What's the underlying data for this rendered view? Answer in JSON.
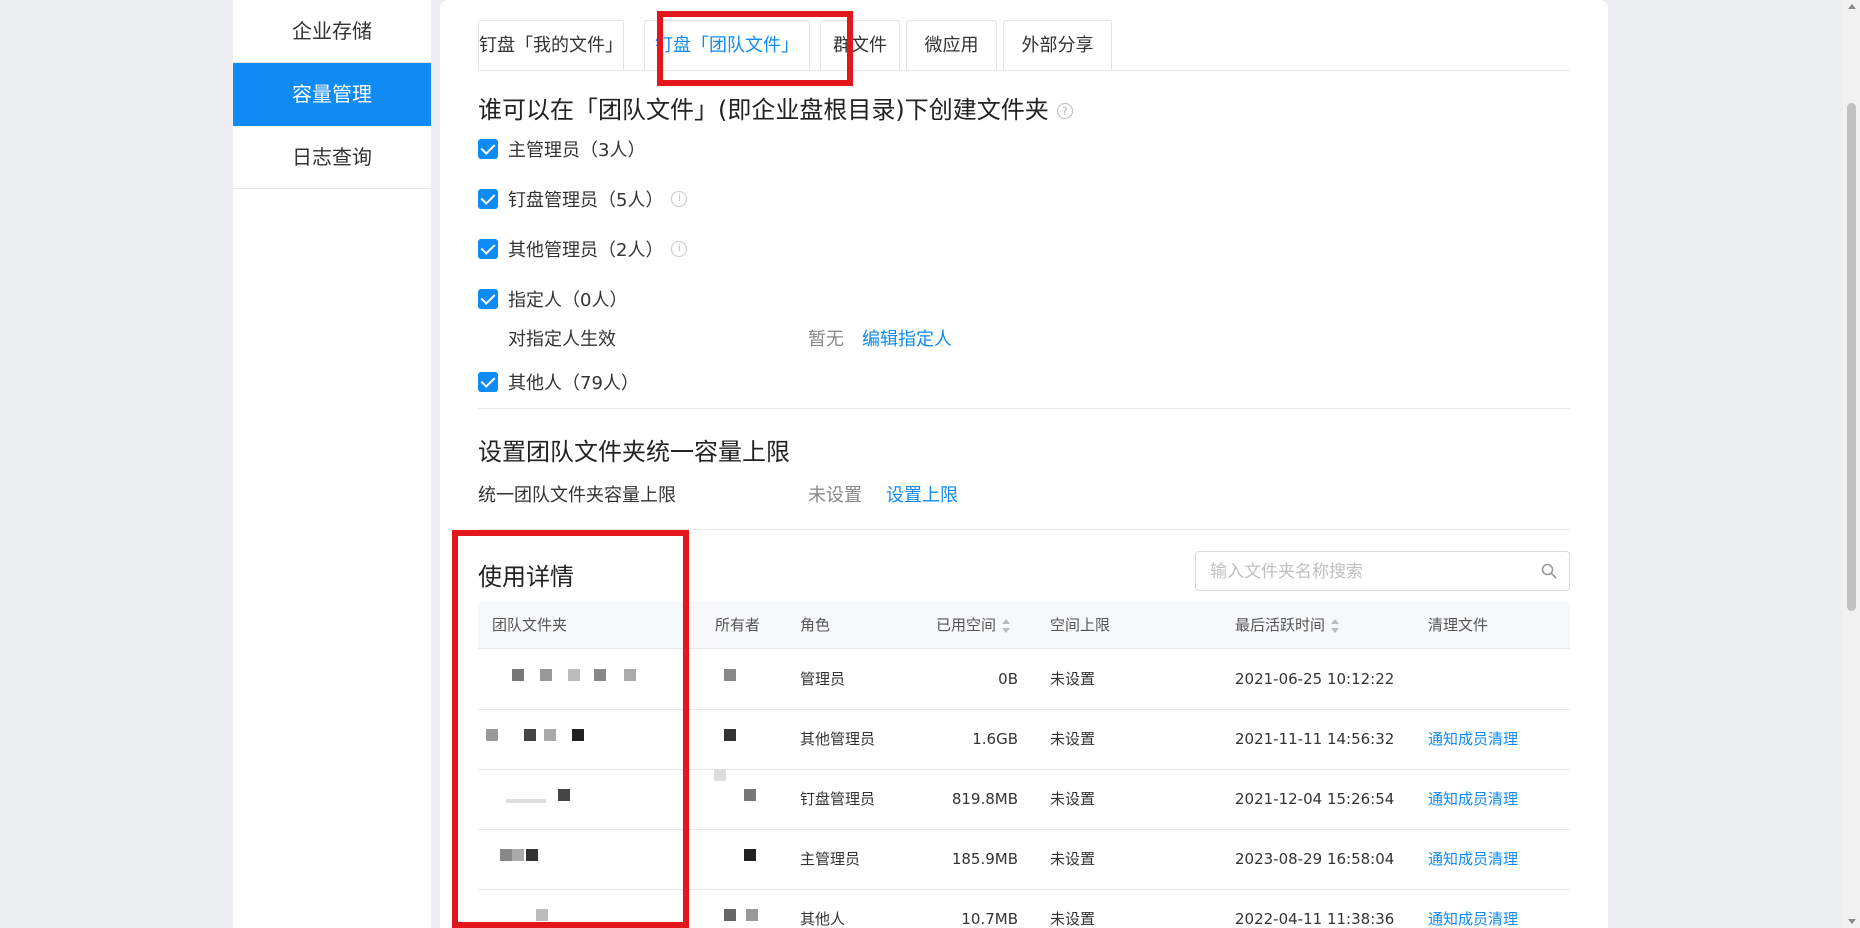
{
  "sidebar": {
    "items": [
      {
        "label": "企业存储",
        "active": false
      },
      {
        "label": "容量管理",
        "active": true
      },
      {
        "label": "日志查询",
        "active": false
      }
    ]
  },
  "tabs": [
    {
      "label": "钉盘「我的文件」",
      "active": false
    },
    {
      "label": "钉盘「团队文件」",
      "active": true
    },
    {
      "label": "群文件",
      "active": false
    },
    {
      "label": "微应用",
      "active": false
    },
    {
      "label": "外部分享",
      "active": false
    }
  ],
  "create_section": {
    "title": "谁可以在「团队文件」(即企业盘根目录)下创建文件夹",
    "options": [
      {
        "label": "主管理员（3人）",
        "checked": true,
        "info": false
      },
      {
        "label": "钉盘管理员（5人）",
        "checked": true,
        "info": true
      },
      {
        "label": "其他管理员（2人）",
        "checked": true,
        "info": true
      },
      {
        "label": "指定人（0人）",
        "checked": true,
        "info": false
      },
      {
        "label": "其他人（79人）",
        "checked": true,
        "info": false
      }
    ],
    "designated": {
      "label": "对指定人生效",
      "value": "暂无",
      "action": "编辑指定人"
    }
  },
  "limit_section": {
    "title": "设置团队文件夹统一容量上限",
    "label": "统一团队文件夹容量上限",
    "value": "未设置",
    "action": "设置上限"
  },
  "usage_section": {
    "title": "使用详情",
    "search_placeholder": "输入文件夹名称搜索",
    "columns": {
      "folder": "团队文件夹",
      "owner": "所有者",
      "role": "角色",
      "used": "已用空间",
      "limit": "空间上限",
      "last_active": "最后活跃时间",
      "clean": "清理文件"
    },
    "rows": [
      {
        "role": "管理员",
        "used": "0B",
        "limit": "未设置",
        "last_active": "2021-06-25 10:12:22",
        "clean": ""
      },
      {
        "role": "其他管理员",
        "used": "1.6GB",
        "limit": "未设置",
        "last_active": "2021-11-11 14:56:32",
        "clean": "通知成员清理"
      },
      {
        "role": "钉盘管理员",
        "used": "819.8MB",
        "limit": "未设置",
        "last_active": "2021-12-04 15:26:54",
        "clean": "通知成员清理"
      },
      {
        "role": "主管理员",
        "used": "185.9MB",
        "limit": "未设置",
        "last_active": "2023-08-29 16:58:04",
        "clean": "通知成员清理"
      },
      {
        "role": "其他人",
        "used": "10.7MB",
        "limit": "未设置",
        "last_active": "2022-04-11 11:38:36",
        "clean": "通知成员清理"
      }
    ]
  },
  "colors": {
    "accent": "#0f8bf5",
    "highlight": "#e3161b"
  }
}
